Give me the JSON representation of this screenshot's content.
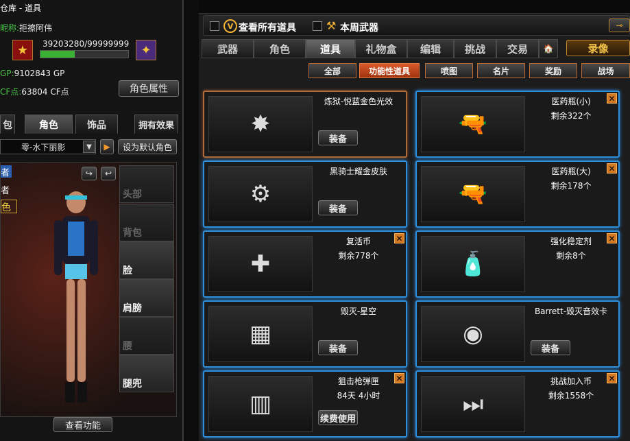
{
  "window_title": "仓库 - 道具",
  "nickname_label": "昵称:",
  "nickname": "拒擦阿伟",
  "exp": "39203280/99999999",
  "exp_progress": 0.39,
  "gp_label": "GP:",
  "gp": "9102843 GP",
  "cf_label": "CF点:",
  "cf": "63804 CF点",
  "role_attr_button": "角色属性",
  "left_tabs": [
    "包",
    "角色",
    "饰品",
    "拥有效果"
  ],
  "character_select": "零-水下丽影",
  "set_default_button": "设为默认角色",
  "side_labels": [
    "者",
    "者",
    "色"
  ],
  "equip_slots": [
    "头部",
    "背包",
    "脸",
    "肩膀",
    "腰",
    "腿兜"
  ],
  "view_function_button": "查看功能",
  "filter_all": "查看所有道具",
  "filter_week": "本周武器",
  "main_tabs": [
    "武器",
    "角色",
    "道具",
    "礼物盒",
    "编辑",
    "挑战",
    "交易",
    "🏠"
  ],
  "record_button": "录像",
  "sub_tabs": [
    "全部",
    "功能性道具",
    "喷图",
    "名片",
    "奖励",
    "战场"
  ],
  "items": [
    {
      "name": "炼狱-悦蓝金色光效",
      "count": "",
      "action": "装备",
      "icon": "✸",
      "removable": false
    },
    {
      "name": "医药瓶(小)",
      "count": "剩余322个",
      "action": "",
      "icon": "🔫",
      "removable": true
    },
    {
      "name": "黑骑士耀金皮肤",
      "count": "",
      "action": "装备",
      "icon": "⚙",
      "removable": false
    },
    {
      "name": "医药瓶(大)",
      "count": "剩余178个",
      "action": "",
      "icon": "🔫",
      "removable": true
    },
    {
      "name": "复活币",
      "count": "剩余778个",
      "action": "",
      "icon": "✚",
      "removable": true
    },
    {
      "name": "强化稳定剂",
      "count": "剩余8个",
      "action": "",
      "icon": "🧴",
      "removable": true
    },
    {
      "name": "毁灭-星空",
      "count": "",
      "action": "装备",
      "icon": "▦",
      "removable": false
    },
    {
      "name": "Barrett-毁灭音效卡",
      "count": "",
      "action": "装备",
      "icon": "◉",
      "removable": false
    },
    {
      "name": "狙击枪弹匣",
      "count": "84天 4小时",
      "action": "续费使用",
      "icon": "▥",
      "removable": true
    },
    {
      "name": "挑战加入币",
      "count": "剩余1558个",
      "action": "",
      "icon": "⏭",
      "removable": true
    }
  ],
  "colors": {
    "accent_orange": "#d85a2c",
    "card_border_blue": "#2e8fdc",
    "xp_green": "#3bb133"
  }
}
